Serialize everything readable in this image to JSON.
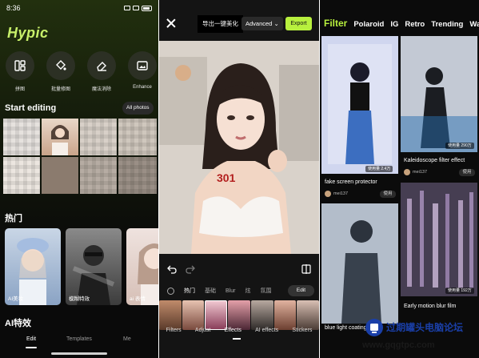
{
  "left_panel": {
    "status": {
      "time": "8:36"
    },
    "app_name": "Hypic",
    "tools": [
      {
        "label": "拼图",
        "icon": "collage-icon"
      },
      {
        "label": "批量修图",
        "icon": "bucket-icon"
      },
      {
        "label": "魔法消除",
        "icon": "eraser-icon"
      },
      {
        "label": "Enhance",
        "icon": "image-enhance-icon"
      }
    ],
    "start_editing": "Start editing",
    "all_photos": "All photos",
    "hot_title": "热门",
    "hot_items": [
      "AI美妆",
      "模糊特效",
      "ai 表情"
    ],
    "ai_effects_title": "AI特效",
    "nav": [
      "Edit",
      "Templates",
      "Me"
    ]
  },
  "editor_panel": {
    "export_cn": "导出一键美化",
    "advanced": "Advanced",
    "export_btn": "Export",
    "tabs": [
      "热门",
      "基础",
      "Blur",
      "炫",
      "氛围"
    ],
    "edit_label": "Edit",
    "bottom_tabs": [
      "Filters",
      "Adjust",
      "Effects",
      "AI effects",
      "Stickers"
    ]
  },
  "right_panel": {
    "tabs": [
      "Filter",
      "Polaroid",
      "IG",
      "Retro",
      "Trending",
      "Wallp"
    ],
    "cards": [
      {
        "caption": "fake screen protector",
        "user": "mei137",
        "use_count": "使用量 2.4万",
        "use": "使用"
      },
      {
        "caption": "Kaleidoscope filter effect",
        "user": "mei137",
        "use_count": "使用量 290万",
        "use": "使用"
      },
      {
        "caption": "blue light coating",
        "user": "",
        "use_count": "",
        "use": ""
      },
      {
        "caption": "Early motion blur film",
        "user": "",
        "use_count": "使用量 192万",
        "use": ""
      }
    ]
  },
  "watermark": {
    "text": "过期罐头电脑论坛",
    "url": "www.gqgtpc.com"
  },
  "colors": {
    "accent": "#b8f03e",
    "bg_dark": "#0b0b0b"
  }
}
